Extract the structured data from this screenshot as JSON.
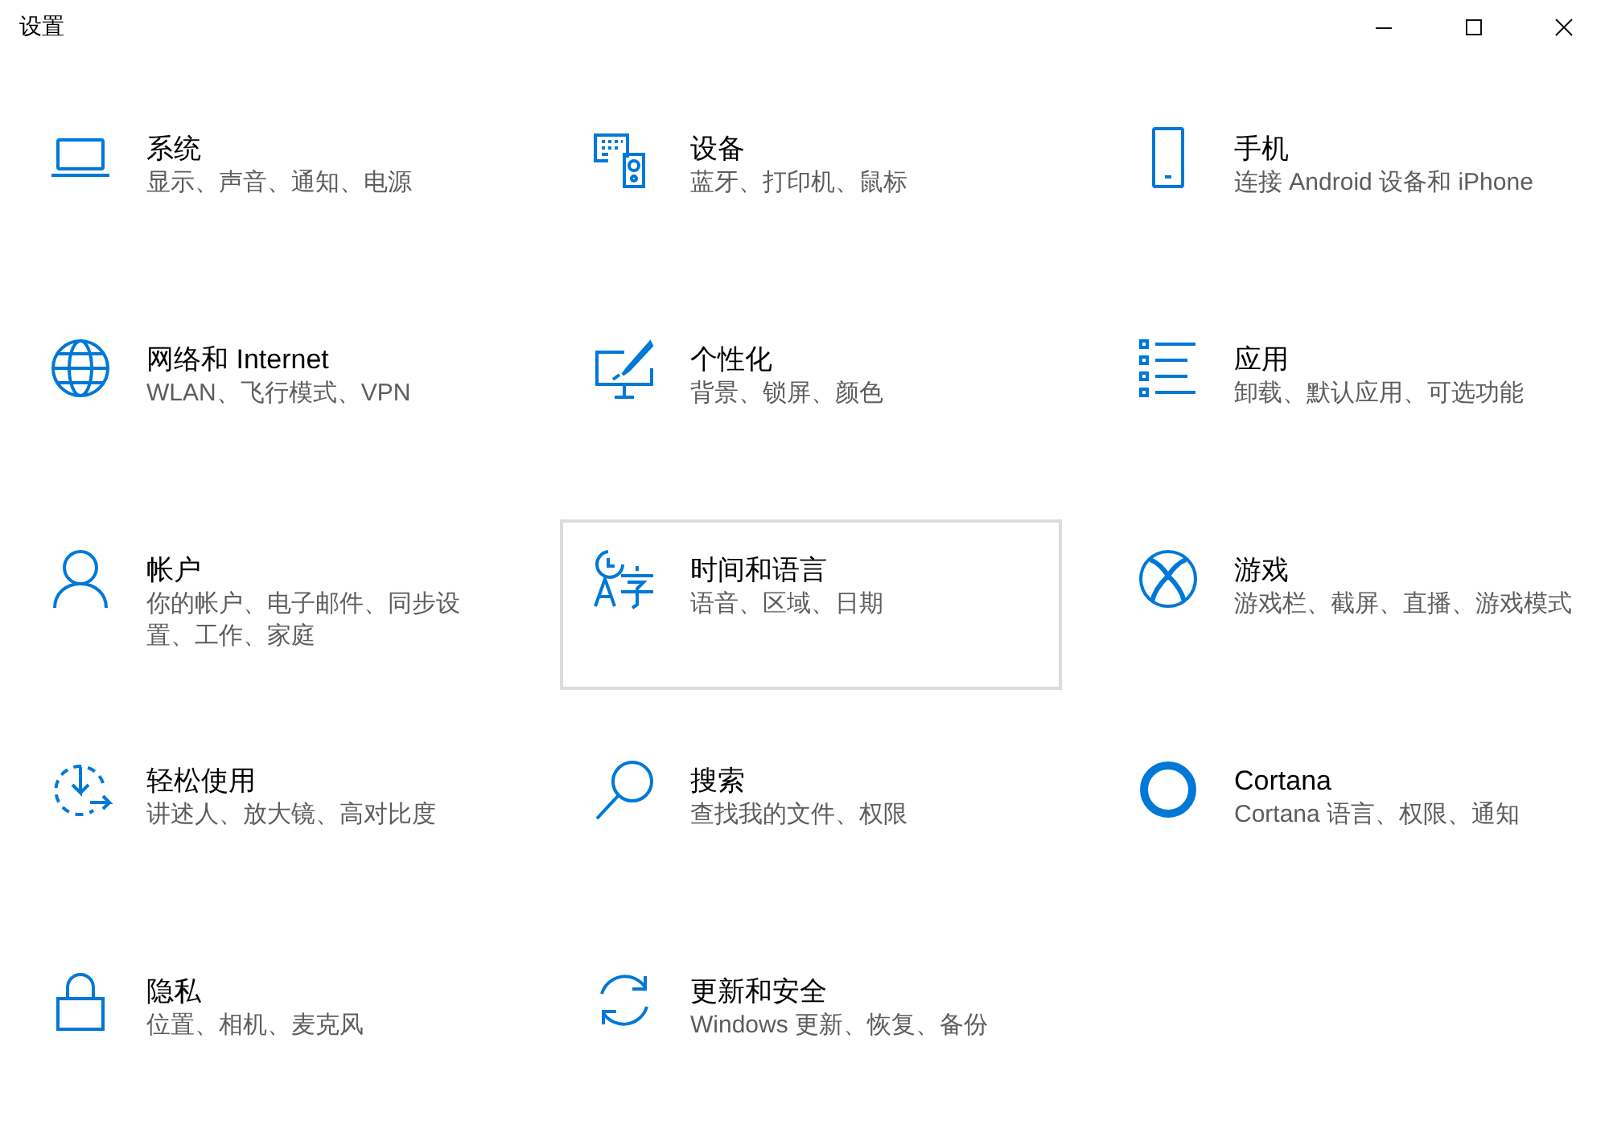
{
  "window": {
    "title": "设置"
  },
  "categories": [
    {
      "title": "系统",
      "description": "显示、声音、通知、电源",
      "highlighted": false
    },
    {
      "title": "设备",
      "description": "蓝牙、打印机、鼠标",
      "highlighted": false
    },
    {
      "title": "手机",
      "description": "连接 Android 设备和 iPhone",
      "highlighted": false
    },
    {
      "title": "网络和 Internet",
      "description": "WLAN、飞行模式、VPN",
      "highlighted": false
    },
    {
      "title": "个性化",
      "description": "背景、锁屏、颜色",
      "highlighted": false
    },
    {
      "title": "应用",
      "description": "卸载、默认应用、可选功能",
      "highlighted": false
    },
    {
      "title": "帐户",
      "description": "你的帐户、电子邮件、同步设置、工作、家庭",
      "highlighted": false
    },
    {
      "title": "时间和语言",
      "description": "语音、区域、日期",
      "highlighted": true
    },
    {
      "title": "游戏",
      "description": "游戏栏、截屏、直播、游戏模式",
      "highlighted": false
    },
    {
      "title": "轻松使用",
      "description": "讲述人、放大镜、高对比度",
      "highlighted": false
    },
    {
      "title": "搜索",
      "description": "查找我的文件、权限",
      "highlighted": false
    },
    {
      "title": "Cortana",
      "description": "Cortana 语言、权限、通知",
      "highlighted": false
    },
    {
      "title": "隐私",
      "description": "位置、相机、麦克风",
      "highlighted": false
    },
    {
      "title": "更新和安全",
      "description": "Windows 更新、恢复、备份",
      "highlighted": false
    }
  ]
}
